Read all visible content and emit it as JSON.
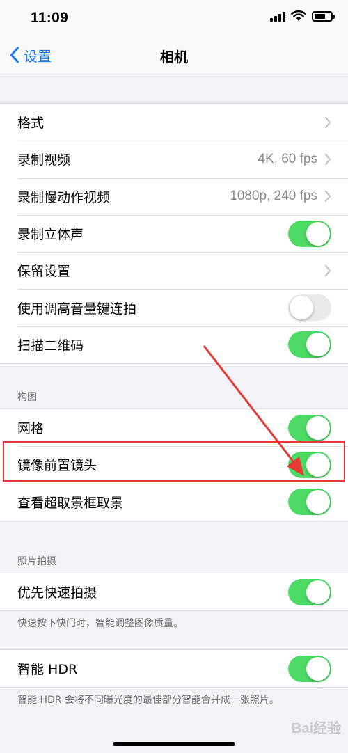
{
  "status_bar": {
    "time": "11:09"
  },
  "nav": {
    "back_label": "设置",
    "title": "相机"
  },
  "group1": [
    {
      "label": "格式",
      "value": "",
      "control": "chevron"
    },
    {
      "label": "录制视频",
      "value": "4K, 60 fps",
      "control": "chevron"
    },
    {
      "label": "录制慢动作视频",
      "value": "1080p, 240 fps",
      "control": "chevron"
    },
    {
      "label": "录制立体声",
      "control": "toggle",
      "on": true
    },
    {
      "label": "保留设置",
      "value": "",
      "control": "chevron"
    },
    {
      "label": "使用调高音量键连拍",
      "control": "toggle",
      "on": false
    },
    {
      "label": "扫描二维码",
      "control": "toggle",
      "on": true
    }
  ],
  "composition": {
    "header": "构图",
    "rows": [
      {
        "label": "网格",
        "on": true
      },
      {
        "label": "镜像前置镜头",
        "on": true
      },
      {
        "label": "查看超取景框取景",
        "on": true
      }
    ]
  },
  "photo_capture": {
    "header": "照片拍摄",
    "row": {
      "label": "优先快速拍摄",
      "on": true
    },
    "footnote": "快速按下快门时，智能调整图像质量。"
  },
  "hdr": {
    "row": {
      "label": "智能 HDR",
      "on": true
    },
    "footnote": "智能 HDR 会将不同曝光度的最佳部分智能合并成一张照片。"
  },
  "watermark": "Bai经验",
  "colors": {
    "accent": "#1a7cf4",
    "toggle_on": "#4cd964",
    "toggle_off": "#e9e9ea",
    "annotation": "#e53935"
  }
}
